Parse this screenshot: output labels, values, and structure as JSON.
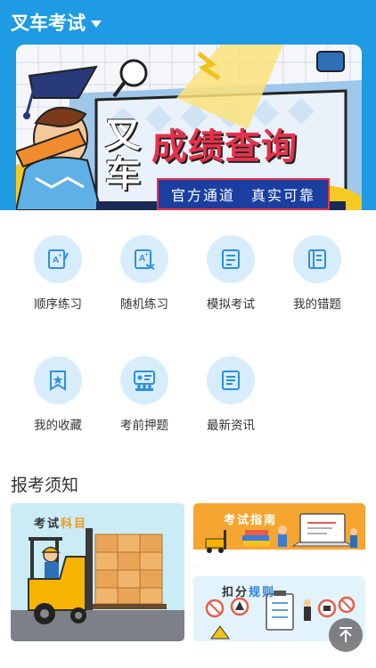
{
  "header": {
    "title": "叉车考试"
  },
  "banner": {
    "left_chars": "叉车",
    "title": "成绩查询",
    "subtitle": "官方通道　真实可靠"
  },
  "grid": {
    "items": [
      {
        "label": "顺序练习",
        "icon": "sequential-practice-icon"
      },
      {
        "label": "随机练习",
        "icon": "random-practice-icon"
      },
      {
        "label": "模拟考试",
        "icon": "mock-exam-icon"
      },
      {
        "label": "我的错题",
        "icon": "wrong-questions-icon"
      },
      {
        "label": "我的收藏",
        "icon": "favorites-icon"
      },
      {
        "label": "考前押题",
        "icon": "pre-exam-questions-icon"
      },
      {
        "label": "最新资讯",
        "icon": "news-icon"
      }
    ]
  },
  "section": {
    "title": "报考须知"
  },
  "cards": {
    "subjects": {
      "part1": "考试",
      "part2": "科目"
    },
    "guide": {
      "part1": "考试",
      "part2": "指南"
    },
    "deduct": {
      "part1": "扣分",
      "part2": "规则"
    }
  },
  "colors": {
    "header_blue": "#1e9be3",
    "icon_circle": "#d7edfb",
    "icon_blue": "#2f8fe0",
    "guide_orange": "#f7a531",
    "banner_red": "#e8304a"
  }
}
